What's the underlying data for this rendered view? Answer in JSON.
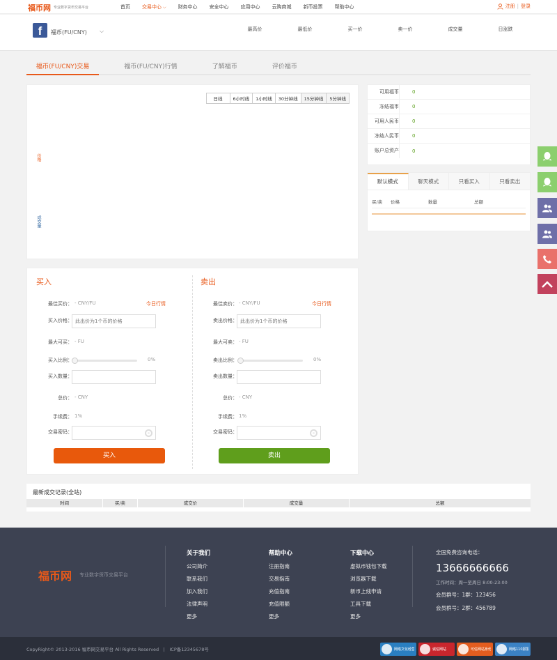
{
  "topbar": {
    "logo": "福币网",
    "logo_sub": "专业数字货币交易平台",
    "nav": [
      "首页",
      "交易中心",
      "财务中心",
      "安全中心",
      "应用中心",
      "云购商城",
      "新币投票",
      "帮助中心"
    ],
    "register": "注册",
    "divider": "|",
    "login": "登录"
  },
  "market": {
    "coin_name": "福币(FU/CNY)",
    "stats": [
      "最高价",
      "最低价",
      "买一价",
      "卖一价",
      "成交量",
      "日涨跌"
    ]
  },
  "tabs": [
    "福币(FU/CNY)交易",
    "福币(FU/CNY)行情",
    "了解福币",
    "评价福币"
  ],
  "chart": {
    "intervals": [
      "日线",
      "6小时线",
      "1小时线",
      "30分钟线",
      "15分钟线",
      "5分钟线"
    ],
    "price_label": "价格",
    "volume_label": "成交量"
  },
  "assets": [
    {
      "label": "可用福币",
      "value": "0"
    },
    {
      "label": "冻结福币",
      "value": "0"
    },
    {
      "label": "可用人民币",
      "value": "0"
    },
    {
      "label": "冻结人民币",
      "value": "0"
    },
    {
      "label": "账户总资产",
      "value": "0"
    }
  ],
  "orders": {
    "tabs": [
      "默认模式",
      "聊天模式",
      "只看买入",
      "只看卖出"
    ],
    "head": [
      "买/卖",
      "价格",
      "数量",
      "总额"
    ]
  },
  "buy": {
    "title": "买入",
    "best_price_label": "最佳买价：",
    "best_price_value": "- CNY/FU",
    "today_link": "今日行情",
    "price_label": "买入价格：",
    "price_placeholder": "此出价为1个币的价格",
    "max_label": "最大可买：",
    "max_value": "- FU",
    "ratio_label": "买入比例：",
    "ratio_value": "0%",
    "qty_label": "买入数量：",
    "total_label": "总价：",
    "total_value": "- CNY",
    "fee_label": "手续费：",
    "fee_value": "1%",
    "pwd_label": "交易密码：",
    "button": "买入"
  },
  "sell": {
    "title": "卖出",
    "best_price_label": "最佳卖价：",
    "best_price_value": "- CNY/FU",
    "today_link": "今日行情",
    "price_label": "卖出价格：",
    "price_placeholder": "此出价为1个币的价格",
    "max_label": "最大可卖：",
    "max_value": "- FU",
    "ratio_label": "卖出比例：",
    "ratio_value": "0%",
    "qty_label": "卖出数量：",
    "total_label": "总价：",
    "total_value": "- CNY",
    "fee_label": "手续费：",
    "fee_value": "1%",
    "pwd_label": "交易密码：",
    "button": "卖出"
  },
  "records": {
    "title": "最新成交记录(全站)",
    "head": [
      "时间",
      "买/卖",
      "成交价",
      "成交量",
      "总额"
    ]
  },
  "footer": {
    "logo": "福币网",
    "logo_sub": "专业数字货币交易平台",
    "cols": [
      {
        "title": "关于我们",
        "items": [
          "公司简介",
          "联系我们",
          "加入我们",
          "法律声明",
          "更多"
        ]
      },
      {
        "title": "帮助中心",
        "items": [
          "注册指南",
          "交易指南",
          "充值指南",
          "充值限额",
          "更多"
        ]
      },
      {
        "title": "下载中心",
        "items": [
          "虚拟币钱包下载",
          "浏览器下载",
          "新币上线申请",
          "工具下载",
          "更多"
        ]
      }
    ],
    "contact_label": "全国免费咨询电话：",
    "phone": "13666666666",
    "hours": "工作时间：周一至周日 8:00-23:00",
    "group1": "会员群号：1群：123456",
    "group2": "会员群号：2群：456789"
  },
  "bottom": {
    "copyright": "CopyRight© 2013-2016 福币网交易平台 All Rights Reserved　|　ICP备12345678号",
    "badges": [
      "网络文化经营许可证",
      "诚信网站",
      "可信网站身份验证",
      "网络110报警服务"
    ]
  },
  "colors": {
    "accent": "#e8591a",
    "buy_button": "#e8590c",
    "sell_button": "#5f9e1c",
    "footer_bg": "#3d4252"
  }
}
